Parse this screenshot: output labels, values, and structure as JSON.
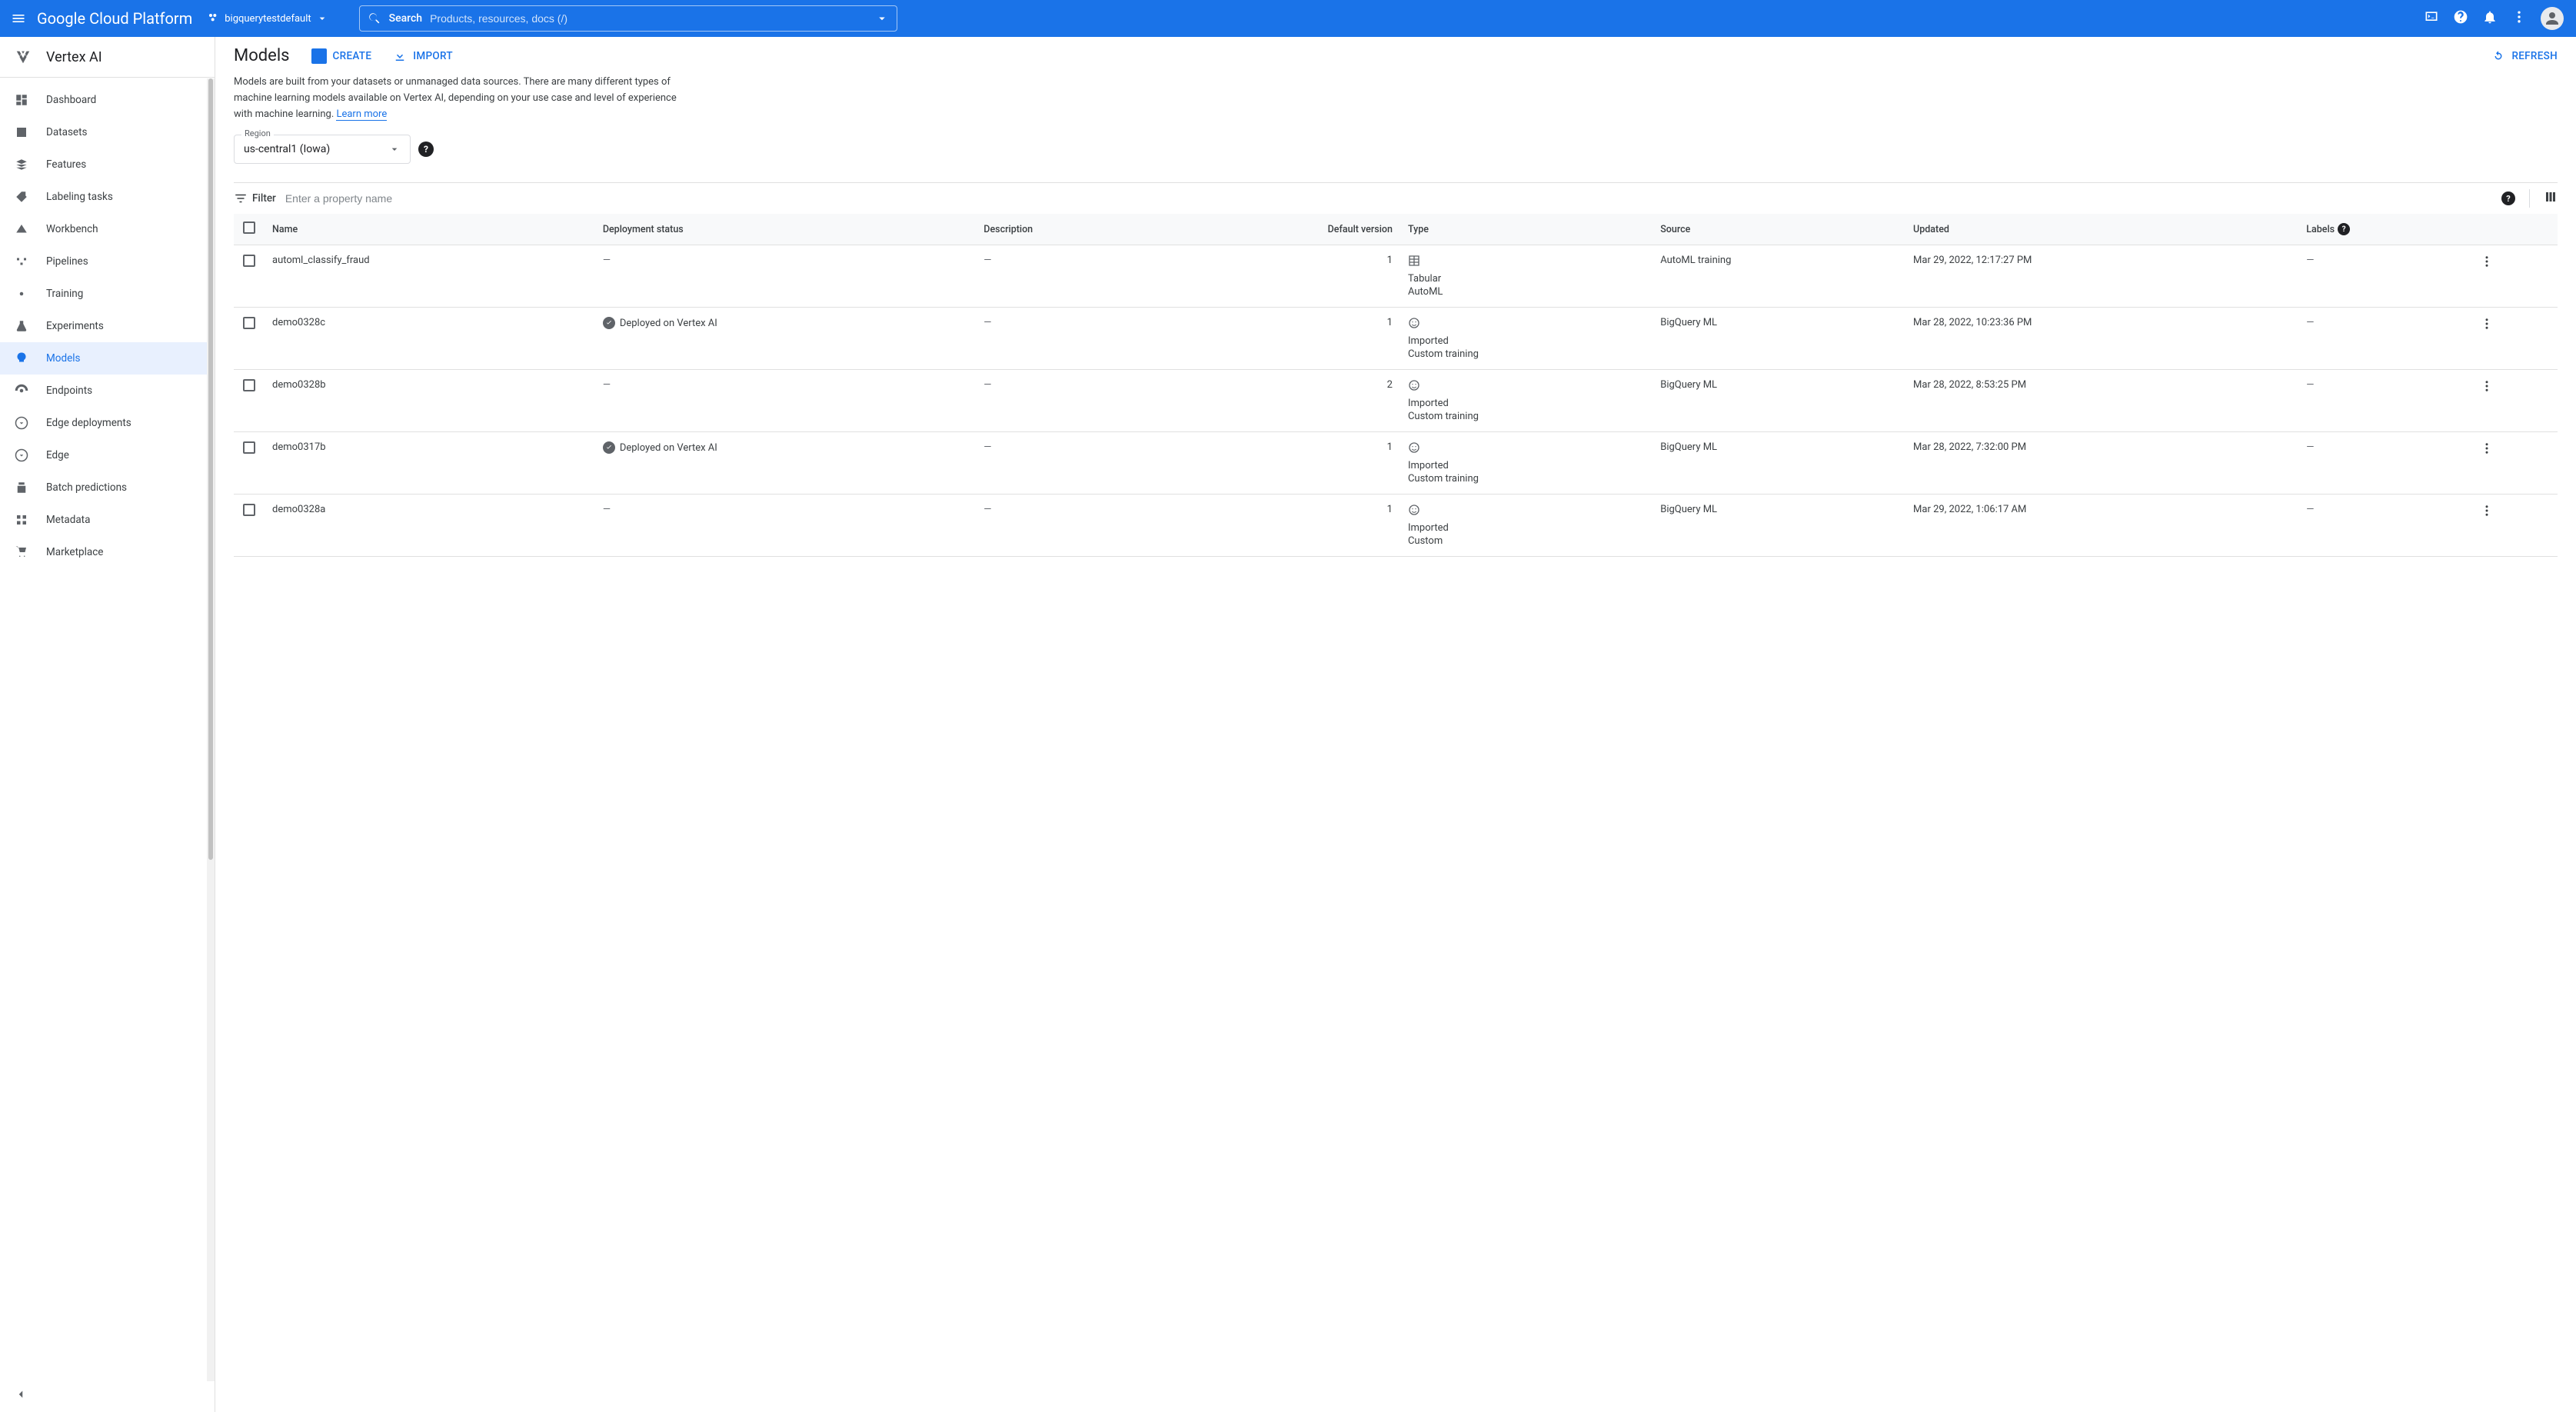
{
  "header": {
    "brand": "Google Cloud Platform",
    "project": "bigquerytestdefault",
    "search_label": "Search",
    "search_placeholder": "Products, resources, docs (/)"
  },
  "sidebar": {
    "title": "Vertex AI",
    "items": [
      {
        "label": "Dashboard",
        "icon": "dashboard",
        "active": false
      },
      {
        "label": "Datasets",
        "icon": "datasets",
        "active": false
      },
      {
        "label": "Features",
        "icon": "features",
        "active": false
      },
      {
        "label": "Labeling tasks",
        "icon": "tag",
        "active": false
      },
      {
        "label": "Workbench",
        "icon": "workbench",
        "active": false
      },
      {
        "label": "Pipelines",
        "icon": "pipelines",
        "active": false
      },
      {
        "label": "Training",
        "icon": "training",
        "active": false
      },
      {
        "label": "Experiments",
        "icon": "flask",
        "active": false
      },
      {
        "label": "Models",
        "icon": "bulb",
        "active": true
      },
      {
        "label": "Endpoints",
        "icon": "endpoints",
        "active": false
      },
      {
        "label": "Edge deployments",
        "icon": "download",
        "active": false
      },
      {
        "label": "Edge",
        "icon": "download",
        "active": false
      },
      {
        "label": "Batch predictions",
        "icon": "batch",
        "active": false
      },
      {
        "label": "Metadata",
        "icon": "metadata",
        "active": false
      },
      {
        "label": "Marketplace",
        "icon": "cart",
        "active": false
      }
    ]
  },
  "page": {
    "title": "Models",
    "create_label": "CREATE",
    "import_label": "IMPORT",
    "refresh_label": "REFRESH",
    "description": "Models are built from your datasets or unmanaged data sources. There are many different types of machine learning models available on Vertex AI, depending on your use case and level of experience with machine learning. ",
    "learn_more": "Learn more",
    "region_label": "Region",
    "region_value": "us-central1 (Iowa)",
    "filter_label": "Filter",
    "filter_placeholder": "Enter a property name"
  },
  "table": {
    "columns": {
      "name": "Name",
      "status": "Deployment status",
      "description": "Description",
      "default_version": "Default version",
      "type": "Type",
      "source": "Source",
      "updated": "Updated",
      "labels": "Labels"
    },
    "rows": [
      {
        "name": "automl_classify_fraud",
        "status": "",
        "description": "",
        "default_version": "1",
        "type_icon": "table",
        "type_lines": [
          "Tabular",
          "AutoML"
        ],
        "source": "AutoML training",
        "updated": "Mar 29, 2022, 12:17:27 PM",
        "labels": ""
      },
      {
        "name": "demo0328c",
        "status": "Deployed on Vertex AI",
        "description": "",
        "default_version": "1",
        "type_icon": "face",
        "type_lines": [
          "Imported",
          "Custom training"
        ],
        "source": "BigQuery ML",
        "updated": "Mar 28, 2022, 10:23:36 PM",
        "labels": ""
      },
      {
        "name": "demo0328b",
        "status": "",
        "description": "",
        "default_version": "2",
        "type_icon": "face",
        "type_lines": [
          "Imported",
          "Custom training"
        ],
        "source": "BigQuery ML",
        "updated": "Mar 28, 2022, 8:53:25 PM",
        "labels": ""
      },
      {
        "name": "demo0317b",
        "status": "Deployed on Vertex AI",
        "description": "",
        "default_version": "1",
        "type_icon": "face",
        "type_lines": [
          "Imported",
          "Custom training"
        ],
        "source": "BigQuery ML",
        "updated": "Mar 28, 2022, 7:32:00 PM",
        "labels": ""
      },
      {
        "name": "demo0328a",
        "status": "",
        "description": "",
        "default_version": "1",
        "type_icon": "face",
        "type_lines": [
          "Imported",
          "Custom"
        ],
        "source": "BigQuery ML",
        "updated": "Mar 29, 2022, 1:06:17 AM",
        "labels": ""
      }
    ]
  }
}
